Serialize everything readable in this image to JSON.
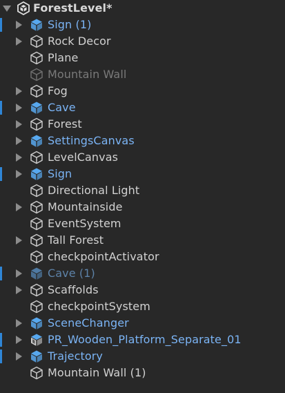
{
  "scene": {
    "title": "ForestLevel*",
    "icon": "unity-logo-icon",
    "expanded": true
  },
  "colors": {
    "background": "#282828",
    "text": "#d2d2d2",
    "prefab_text": "#7bb4f5",
    "inactive_text": "#7a7a7a",
    "prefab_inactive_text": "#5d82a8",
    "modified_marker": "#2f86d6",
    "arrow": "#8c8c8c"
  },
  "items": [
    {
      "label": "Sign (1)",
      "icon": "prefab-cube-icon",
      "kind": "prefab",
      "has_children": true,
      "modified": true
    },
    {
      "label": "Rock Decor",
      "icon": "gameobject-cube-icon",
      "kind": "normal",
      "has_children": true,
      "modified": false
    },
    {
      "label": "Plane",
      "icon": "gameobject-cube-icon",
      "kind": "normal",
      "has_children": false,
      "modified": false
    },
    {
      "label": "Mountain Wall",
      "icon": "gameobject-cube-icon",
      "kind": "inactive",
      "has_children": false,
      "modified": false
    },
    {
      "label": "Fog",
      "icon": "gameobject-cube-icon",
      "kind": "normal",
      "has_children": true,
      "modified": false
    },
    {
      "label": "Cave",
      "icon": "prefab-cube-icon",
      "kind": "prefab",
      "has_children": true,
      "modified": true
    },
    {
      "label": "Forest",
      "icon": "gameobject-cube-icon",
      "kind": "normal",
      "has_children": true,
      "modified": false
    },
    {
      "label": "SettingsCanvas",
      "icon": "prefab-cube-icon",
      "kind": "prefab",
      "has_children": true,
      "modified": false
    },
    {
      "label": "LevelCanvas",
      "icon": "gameobject-cube-icon",
      "kind": "normal",
      "has_children": true,
      "modified": false
    },
    {
      "label": "Sign",
      "icon": "prefab-cube-icon",
      "kind": "prefab",
      "has_children": true,
      "modified": true
    },
    {
      "label": "Directional Light",
      "icon": "gameobject-cube-icon",
      "kind": "normal",
      "has_children": false,
      "modified": false
    },
    {
      "label": "Mountainside",
      "icon": "gameobject-cube-icon",
      "kind": "normal",
      "has_children": true,
      "modified": false
    },
    {
      "label": "EventSystem",
      "icon": "gameobject-cube-icon",
      "kind": "normal",
      "has_children": false,
      "modified": false
    },
    {
      "label": "Tall Forest",
      "icon": "gameobject-cube-icon",
      "kind": "normal",
      "has_children": true,
      "modified": false
    },
    {
      "label": "checkpointActivator",
      "icon": "gameobject-cube-icon",
      "kind": "normal",
      "has_children": false,
      "modified": false
    },
    {
      "label": "Cave (1)",
      "icon": "prefab-cube-icon",
      "kind": "prefab-inactive",
      "has_children": true,
      "modified": true
    },
    {
      "label": "Scaffolds",
      "icon": "gameobject-cube-icon",
      "kind": "normal",
      "has_children": true,
      "modified": false
    },
    {
      "label": "checkpointSystem",
      "icon": "gameobject-cube-icon",
      "kind": "normal",
      "has_children": false,
      "modified": false
    },
    {
      "label": "SceneChanger",
      "icon": "prefab-cube-icon",
      "kind": "prefab",
      "has_children": true,
      "modified": false
    },
    {
      "label": "PR_Wooden_Platform_Separate_01",
      "icon": "model-prefab-icon",
      "kind": "prefab",
      "has_children": true,
      "modified": true
    },
    {
      "label": "Trajectory",
      "icon": "prefab-cube-icon",
      "kind": "prefab",
      "has_children": true,
      "modified": true
    },
    {
      "label": "Mountain Wall (1)",
      "icon": "gameobject-cube-icon",
      "kind": "normal",
      "has_children": false,
      "modified": false
    }
  ]
}
